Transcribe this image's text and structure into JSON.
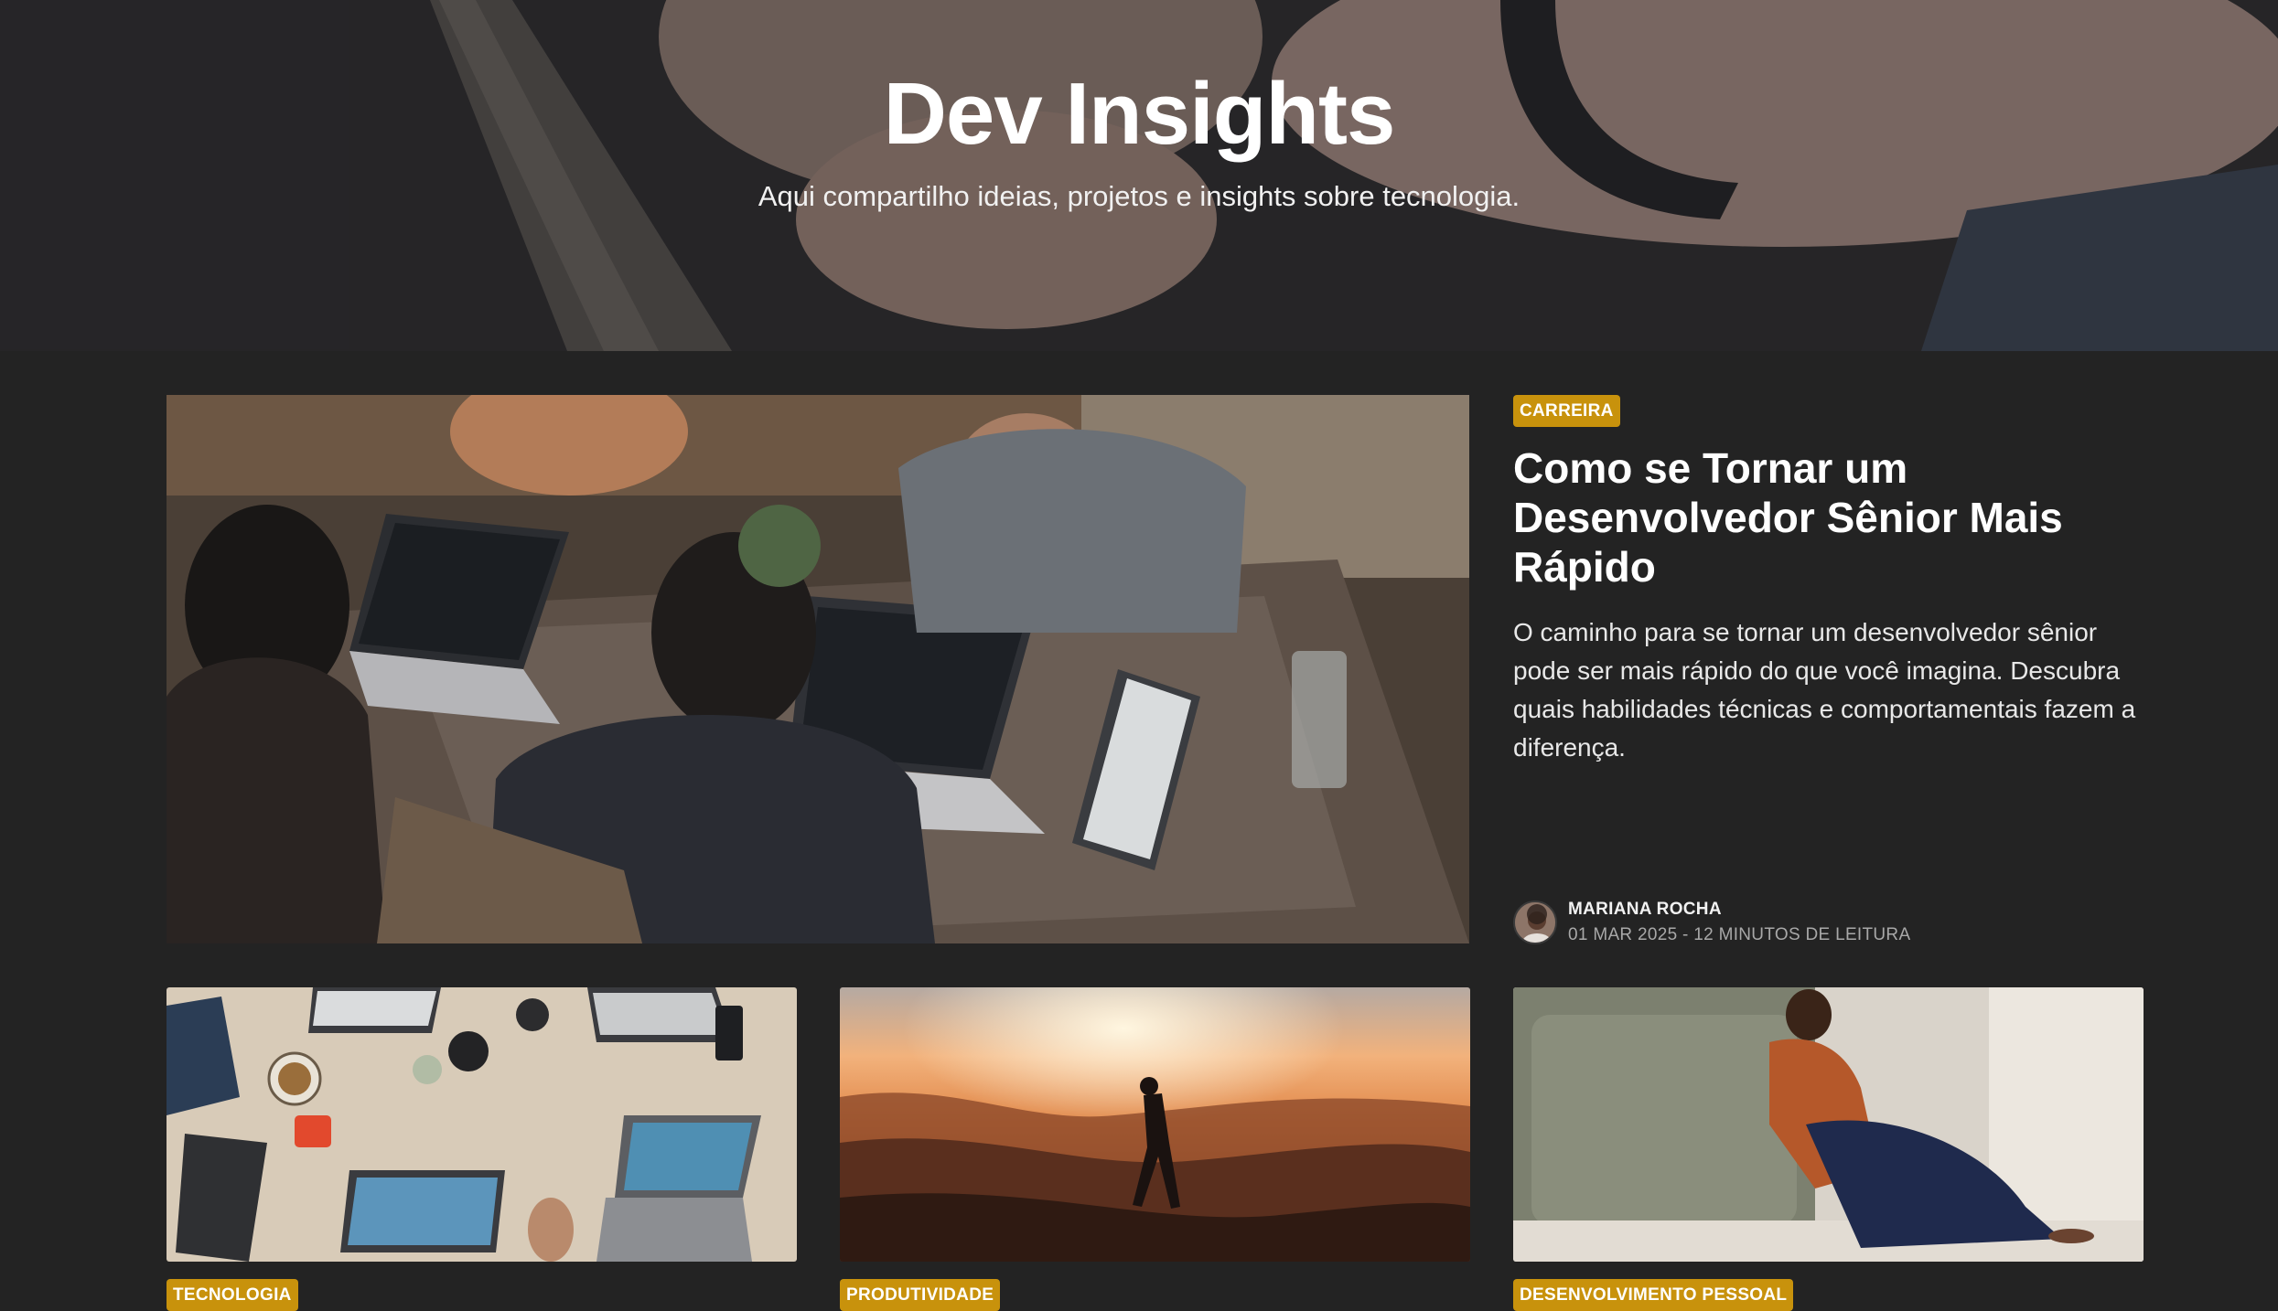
{
  "hero": {
    "title": "Dev Insights",
    "subtitle": "Aqui compartilho ideias, projetos e insights sobre tecnologia."
  },
  "featured": {
    "category": "CARREIRA",
    "title": "Como se Tornar um Desenvolvedor Sênior Mais Rápido",
    "excerpt": "O caminho para se tornar um desenvolvedor sênior pode ser mais rápido do que você imagina. Descubra quais habilidades técnicas e comportamentais fazem a diferença.",
    "author": "MARIANA ROCHA",
    "meta": "01 MAR 2025 - 12 MINUTOS DE LEITURA"
  },
  "cards": [
    {
      "category": "TECNOLOGIA"
    },
    {
      "category": "PRODUTIVIDADE"
    },
    {
      "category": "DESENVOLVIMENTO PESSOAL"
    }
  ],
  "colors": {
    "background": "#232323",
    "badge": "#c8920c"
  }
}
